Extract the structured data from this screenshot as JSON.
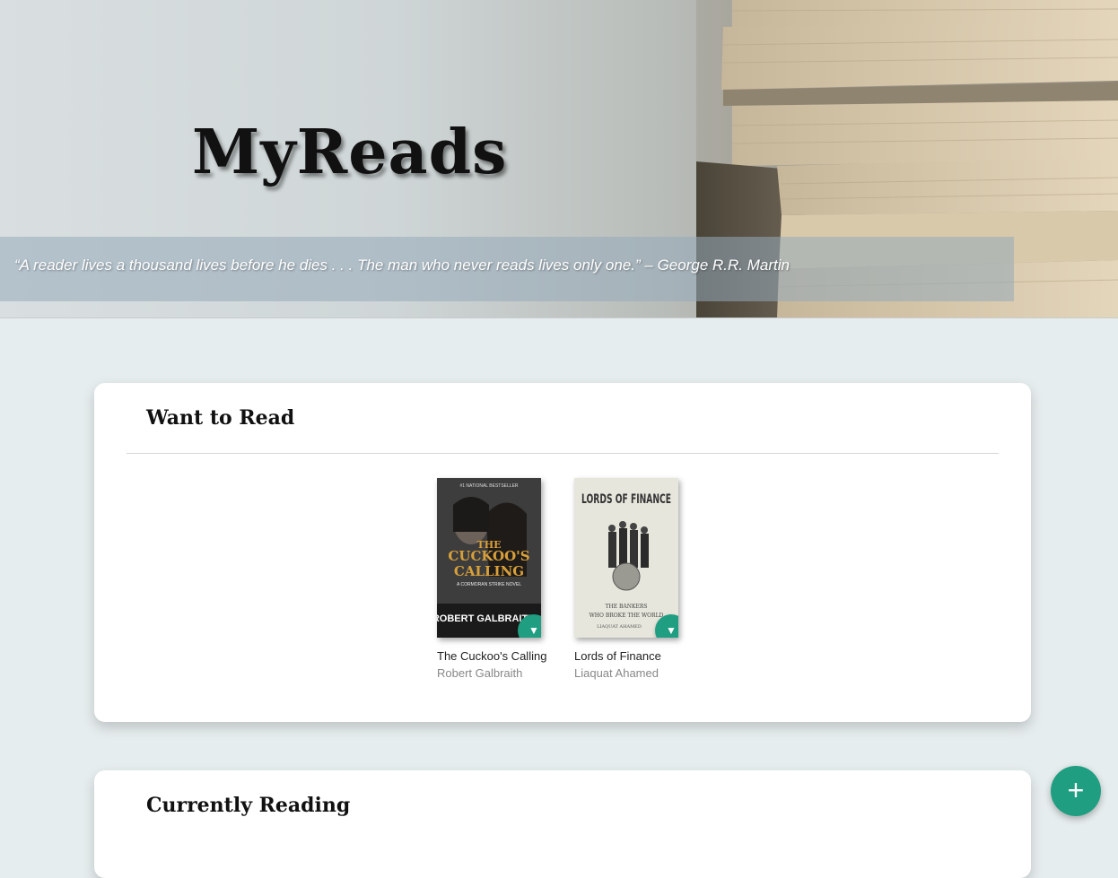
{
  "header": {
    "title": "MyReads",
    "quote": "“A reader lives a thousand lives before he dies . . . The man who never reads lives only one.” – George R.R. Martin"
  },
  "shelves": [
    {
      "title": "Want to Read",
      "books": [
        {
          "title": "The Cuckoo's Calling",
          "author": "Robert Galbraith",
          "cover_icon": "book-cover-cuckoos-calling",
          "cover_text": {
            "top": "#1 NATIONAL BESTSELLER",
            "main1": "THE",
            "main2": "CUCKOO'S",
            "main3": "CALLING",
            "sub": "A CORMORAN STRIKE NOVEL",
            "author": "ROBERT GALBRAITH"
          },
          "changer_icon": "▼"
        },
        {
          "title": "Lords of Finance",
          "author": "Liaquat Ahamed",
          "cover_icon": "book-cover-lords-of-finance",
          "cover_text": {
            "main": "LORDS OF FINANCE",
            "sub1": "THE BANKERS",
            "sub2": "WHO BROKE THE WORLD",
            "author": "LIAQUAT AHAMED"
          },
          "changer_icon": "▼"
        }
      ]
    },
    {
      "title": "Currently Reading",
      "books": []
    }
  ],
  "add_button": {
    "label": "+"
  },
  "colors": {
    "accent": "#1f9e81",
    "page_bg": "#e6edee"
  }
}
